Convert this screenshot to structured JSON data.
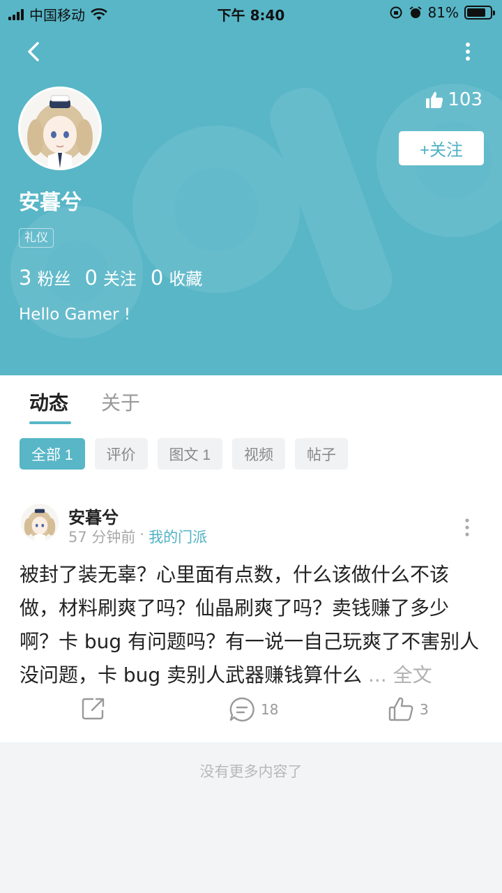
{
  "status_bar": {
    "carrier": "中国移动",
    "time": "下午 8:40",
    "battery": "81%",
    "battery_level": 0.81
  },
  "profile": {
    "name": "安暮兮",
    "tag": "礼仪",
    "likes": "103",
    "follow_label": "+关注",
    "stats": [
      {
        "value": "3",
        "label": "粉丝"
      },
      {
        "value": "0",
        "label": "关注"
      },
      {
        "value": "0",
        "label": "收藏"
      }
    ],
    "bio": "Hello Gamer !"
  },
  "tabs": [
    {
      "label": "动态",
      "active": true
    },
    {
      "label": "关于",
      "active": false
    }
  ],
  "filters": [
    {
      "label": "全部 1",
      "active": true
    },
    {
      "label": "评价",
      "active": false
    },
    {
      "label": "图文 1",
      "active": false
    },
    {
      "label": "视频",
      "active": false
    },
    {
      "label": "帖子",
      "active": false
    }
  ],
  "post": {
    "author": "安暮兮",
    "time": "57 分钟前",
    "separator": "·",
    "group": "我的门派",
    "text": "被封了装无辜？心里面有点数，什么该做什么不该做，材料刷爽了吗？仙晶刷爽了吗？卖钱赚了多少啊？卡 bug 有问题吗？有一说一自己玩爽了不害别人没问题，卡 bug 卖别人武器赚钱算什么",
    "ellipsis": " ... ",
    "more_label": "全文",
    "comments": "18",
    "likes": "3"
  },
  "footer": "没有更多内容了",
  "colors": {
    "accent": "#58b6c7",
    "header_bg": "#58b6c7",
    "link": "#4fb2c4"
  }
}
